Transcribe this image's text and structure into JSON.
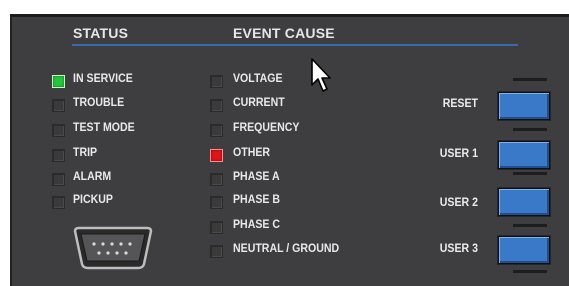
{
  "panel": {
    "status_header": "STATUS",
    "event_header": "EVENT CAUSE",
    "status_items": [
      {
        "label": "IN SERVICE",
        "state": "on",
        "color": "#22c73a"
      },
      {
        "label": "TROUBLE",
        "state": "off"
      },
      {
        "label": "TEST MODE",
        "state": "off"
      },
      {
        "label": "TRIP",
        "state": "off"
      },
      {
        "label": "ALARM",
        "state": "off"
      },
      {
        "label": "PICKUP",
        "state": "off"
      }
    ],
    "event_items": [
      {
        "label": "VOLTAGE",
        "state": "off"
      },
      {
        "label": "CURRENT",
        "state": "off"
      },
      {
        "label": "FREQUENCY",
        "state": "off"
      },
      {
        "label": "OTHER",
        "state": "on",
        "color": "#e0151a"
      },
      {
        "label": "PHASE A",
        "state": "off"
      },
      {
        "label": "PHASE B",
        "state": "off"
      },
      {
        "label": "PHASE C",
        "state": "off"
      },
      {
        "label": "NEUTRAL / GROUND",
        "state": "off"
      }
    ],
    "buttons": [
      {
        "label": "RESET"
      },
      {
        "label": "USER 1"
      },
      {
        "label": "USER 2"
      },
      {
        "label": "USER 3"
      }
    ],
    "button_color": "#3a78c8",
    "accent_rule_color": "#3b6aa8"
  },
  "icons": {
    "serial_port": "db9-serial-port-icon",
    "cursor": "mouse-pointer-icon"
  }
}
